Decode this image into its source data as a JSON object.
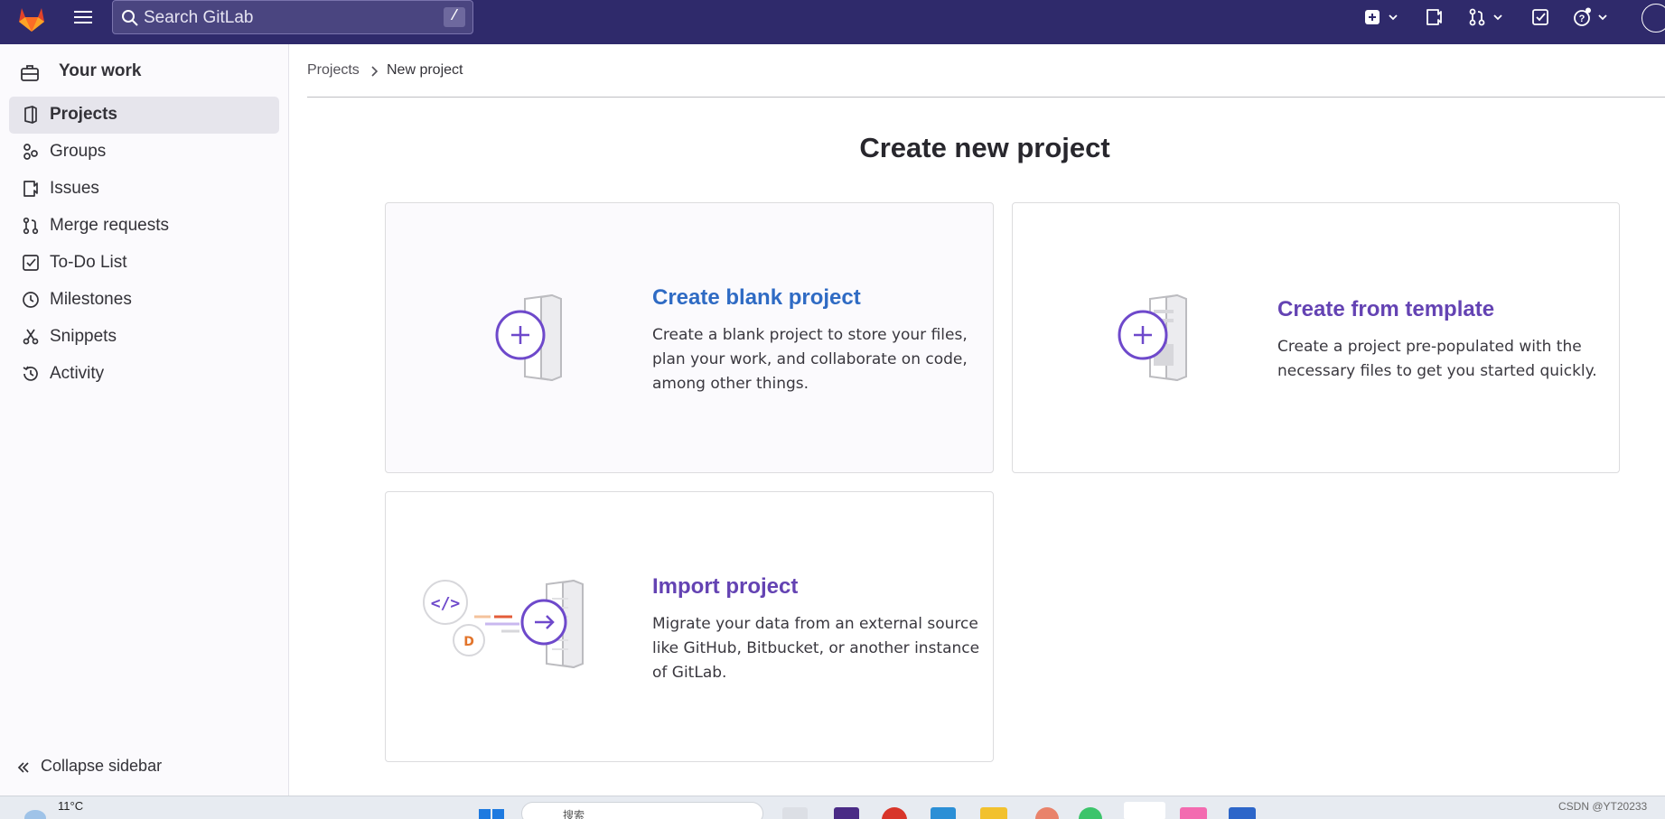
{
  "topbar": {
    "search_placeholder": "Search GitLab",
    "search_shortcut": "/"
  },
  "sidebar": {
    "context_label": "Your work",
    "items": [
      {
        "label": "Projects",
        "icon": "project-icon",
        "active": true
      },
      {
        "label": "Groups",
        "icon": "group-icon"
      },
      {
        "label": "Issues",
        "icon": "issues-icon"
      },
      {
        "label": "Merge requests",
        "icon": "merge-request-icon"
      },
      {
        "label": "To-Do List",
        "icon": "todo-icon"
      },
      {
        "label": "Milestones",
        "icon": "clock-icon"
      },
      {
        "label": "Snippets",
        "icon": "snippet-icon"
      },
      {
        "label": "Activity",
        "icon": "history-icon"
      }
    ],
    "collapse_label": "Collapse sidebar"
  },
  "breadcrumb": {
    "parent": "Projects",
    "current": "New project"
  },
  "page": {
    "title": "Create new project"
  },
  "cards": {
    "blank": {
      "title": "Create blank project",
      "description": "Create a blank project to store your files, plan your work, and collaborate on code, among other things."
    },
    "template": {
      "title": "Create from template",
      "description": "Create a project pre-populated with the necessary files to get you started quickly."
    },
    "import": {
      "title": "Import project",
      "description": "Migrate your data from an external source like GitHub, Bitbucket, or another instance of GitLab."
    }
  },
  "taskbar": {
    "temperature": "11°C",
    "search_text": "搜索",
    "watermark": "CSDN @YT20233"
  },
  "colors": {
    "topbar": "#2f2a6b",
    "link_blue": "#2f6bc4",
    "link_purple": "#6443b3",
    "accent_purple": "#6e49cb"
  }
}
